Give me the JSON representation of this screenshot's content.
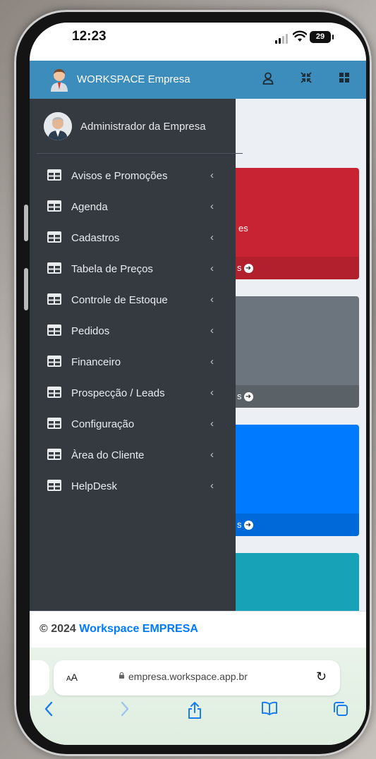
{
  "status_bar": {
    "time": "12:23",
    "battery": "29"
  },
  "app": {
    "brand_name": "WORKSPACE Empresa",
    "user_name": "Administrador da Empresa"
  },
  "menu": {
    "items": [
      {
        "label": "Avisos e Promoções"
      },
      {
        "label": "Agenda"
      },
      {
        "label": "Cadastros"
      },
      {
        "label": "Tabela de Preços"
      },
      {
        "label": "Controle de Estoque"
      },
      {
        "label": "Pedidos"
      },
      {
        "label": "Financeiro"
      },
      {
        "label": "Prospecção / Leads"
      },
      {
        "label": "Configuração"
      },
      {
        "label": "Àrea do Cliente"
      },
      {
        "label": "HelpDesk"
      }
    ]
  },
  "cards": {
    "card1_text": "es",
    "more_suffix": "s"
  },
  "footer": {
    "prefix": "© 2024",
    "brand": "Workspace EMPRESA"
  },
  "browser": {
    "aa": "AA",
    "url": "empresa.workspace.app.br"
  },
  "colors": {
    "primary": "#3c8dbc",
    "sidebar": "#343a40",
    "card_red": "#c82333",
    "card_gray": "#6c757d",
    "card_blue": "#007bff",
    "card_teal": "#17a2b8",
    "footer_brand": "#007bff"
  },
  "icons": {
    "appbar": [
      "user-icon",
      "compress-icon",
      "grid-icon"
    ],
    "menu_item": "table-icon",
    "menu_caret": "chevron-left-icon",
    "toolbar": [
      "back-icon",
      "forward-icon",
      "share-icon",
      "bookmarks-icon",
      "tabs-icon"
    ]
  }
}
